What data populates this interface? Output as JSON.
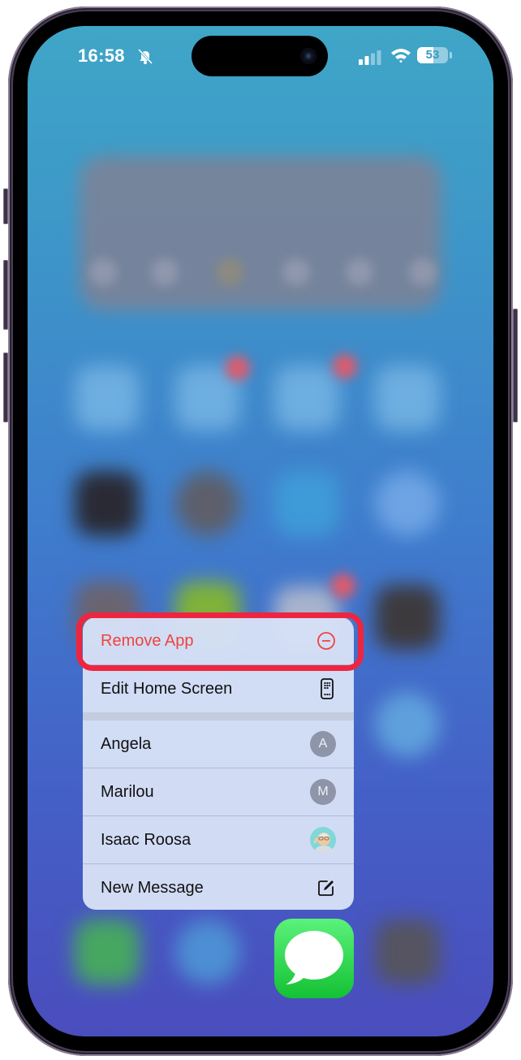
{
  "status_bar": {
    "time": "16:58",
    "silent_mode": true,
    "battery_percent": 53,
    "battery_label": "53",
    "signal_bars_active": 2,
    "signal_bars_total": 4,
    "wifi": true
  },
  "context_menu": {
    "items": [
      {
        "label": "Remove App",
        "icon": "minus-circle-icon",
        "destructive": true,
        "highlighted": true
      },
      {
        "label": "Edit Home Screen",
        "icon": "phone-apps-icon"
      },
      {
        "label": "Angela",
        "avatar_initial": "A"
      },
      {
        "label": "Marilou",
        "avatar_initial": "M"
      },
      {
        "label": "Isaac Roosa",
        "avatar": "memoji"
      },
      {
        "label": "New Message",
        "icon": "compose-icon"
      }
    ]
  },
  "focused_app": {
    "name": "Messages",
    "icon": "messages-bubble-icon"
  },
  "colors": {
    "destructive": "#ef4340",
    "highlight_border": "#ee2540",
    "messages_green": "#14c134"
  }
}
